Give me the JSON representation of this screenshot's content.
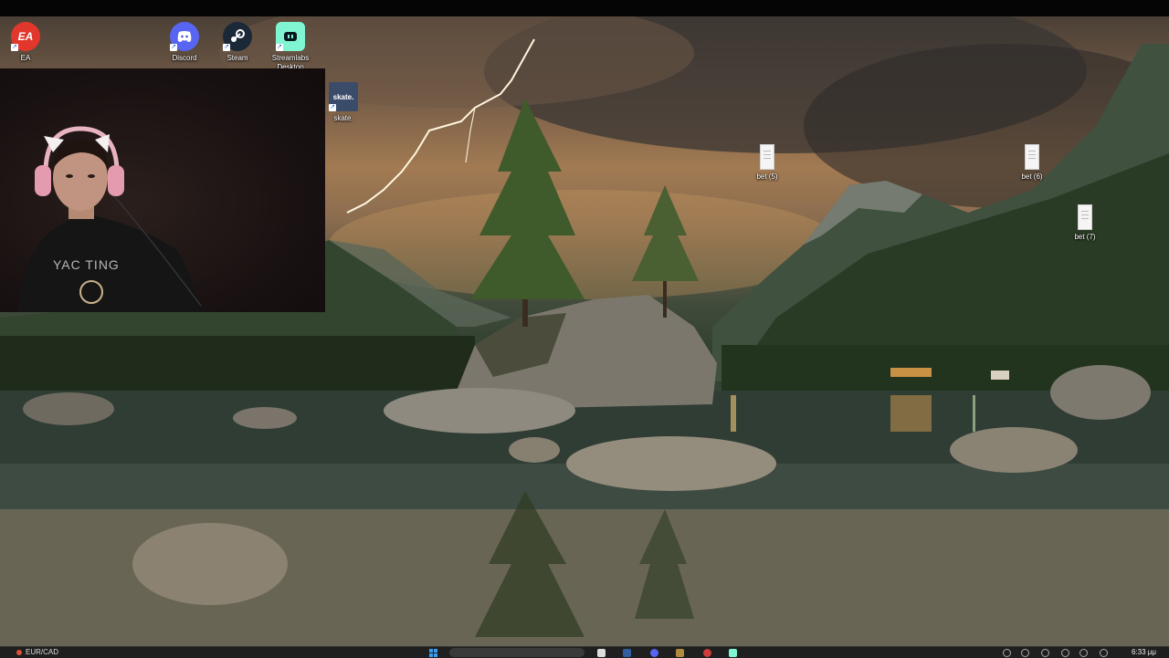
{
  "desktop": {
    "icons": [
      {
        "label": "EA",
        "icon": "ea-icon",
        "color": "#e2372c"
      },
      {
        "label": "Discord",
        "icon": "discord-icon",
        "color": "#5865f2"
      },
      {
        "label": "Steam",
        "icon": "steam-icon",
        "color": "#1b2838"
      },
      {
        "label": "Streamlabs Desktop",
        "icon": "streamlabs-icon",
        "color": "#80f5d2"
      },
      {
        "label": "skate.",
        "icon": "skate-icon",
        "color": "#3a4c6a"
      },
      {
        "label": "bet (5)",
        "icon": "file-icon"
      },
      {
        "label": "bet (6)",
        "icon": "file-icon"
      },
      {
        "label": "bet (7)",
        "icon": "file-icon"
      }
    ]
  },
  "webcam": {
    "shirt_text": "YAC TING"
  },
  "taskbar": {
    "weather_text": "EUR/CAD",
    "time": "6:33 μμ",
    "start_color": "#3b9cf0",
    "apps": [
      "file-explorer-icon",
      "app-icon",
      "discord-icon",
      "app-icon",
      "steam-icon",
      "streamlabs-icon"
    ]
  }
}
